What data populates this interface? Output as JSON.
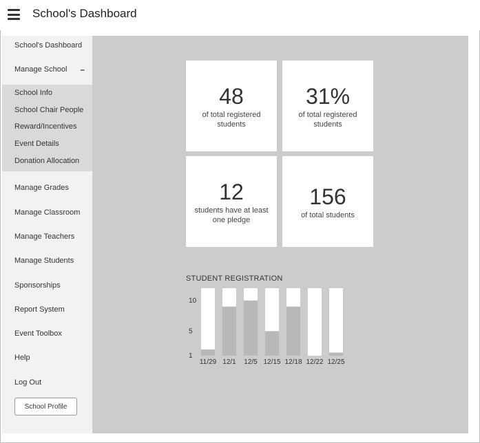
{
  "header": {
    "title": "School's Dashboard",
    "menu_icon": "hamburger-icon"
  },
  "sidebar": {
    "dashboard": "School's Dashboard",
    "manage_school": "Manage School",
    "manage_school_toggle": "–",
    "sub_items": [
      "School Info",
      "School Chair People",
      "Reward/Incentives",
      "Event Details",
      "Donation Allocation"
    ],
    "items": [
      "Manage Grades",
      "Manage Classroom",
      "Manage Teachers",
      "Manage Students",
      "Sponsorships",
      "Report System",
      "Event Toolbox",
      "Help",
      "Log Out"
    ],
    "profile_button": "School Profile"
  },
  "stats": [
    {
      "value": "48",
      "label": "of total registered students"
    },
    {
      "value": "31%",
      "label": "of total registered students"
    },
    {
      "value": "12",
      "label": "students have at least one pledge"
    },
    {
      "value": "156",
      "label": "of total students"
    }
  ],
  "chart_data": {
    "type": "bar",
    "title": "STUDENT REGISTRATION",
    "categories": [
      "11/29",
      "12/1",
      "12/5",
      "12/15",
      "12/18",
      "12/22",
      "12/25"
    ],
    "values": [
      2,
      9,
      10,
      5,
      9,
      1,
      1.5
    ],
    "y_ticks": [
      1,
      5,
      10
    ],
    "ylim": [
      1,
      12
    ],
    "xlabel": "",
    "ylabel": "",
    "colors": {
      "filled": "#b8b8b8",
      "track": "#ffffff"
    }
  }
}
